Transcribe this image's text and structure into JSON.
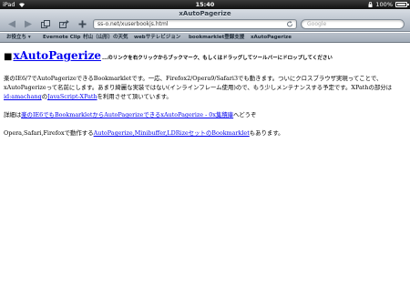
{
  "status_bar": {
    "device": "iPad",
    "time": "15:40",
    "battery": "100%"
  },
  "toolbar": {
    "page_title": "xAutoPagerize",
    "url": "ss-o.net/xuserbookjs.html",
    "search_placeholder": "Google"
  },
  "bookmarks": [
    "お役立ち ▾",
    "Evernote Clip",
    "村山（山形）の天気",
    "webサテレビジョン",
    "bookmarklet登録支援",
    "xAutoPagerize"
  ],
  "content": {
    "square": "■",
    "bookmarklet_link": "xAutoPagerize",
    "hint": "...のリンクを右クリックからブックマーク、もしくはドラッグしてツールバーにドロップしてください",
    "para1_text1": "楽のIE6/7でAutoPagerizeできるBookmarkletです。一応、Firefox2/Opera9/Safari3でも動きます。ついにクロスブラウザ実現ってことで、xAutoPagerizeって名前にします。あまり綺麗な実装ではない(インラインフレーム使用)ので、もう少しメンテナンスする予定です。XPathの部分は",
    "para1_link1": "id:amachang",
    "para1_text2": "の",
    "para1_link2": "JavaScript-XPath",
    "para1_text3": "を利用させて頂いています。",
    "para2_text1": "詳細は",
    "para2_link": "楽のIE6でもBookmarkletからAutoPagerizeできるxAutoPagerize - 0x集積庫",
    "para2_text2": "へどうぞ",
    "para3_text1": "Opera,Safari,Firefoxで動作する",
    "para3_link": "AutoPagerize,Minibuffer,LDRizeセットのBookmarklet",
    "para3_text2": "もあります。"
  }
}
